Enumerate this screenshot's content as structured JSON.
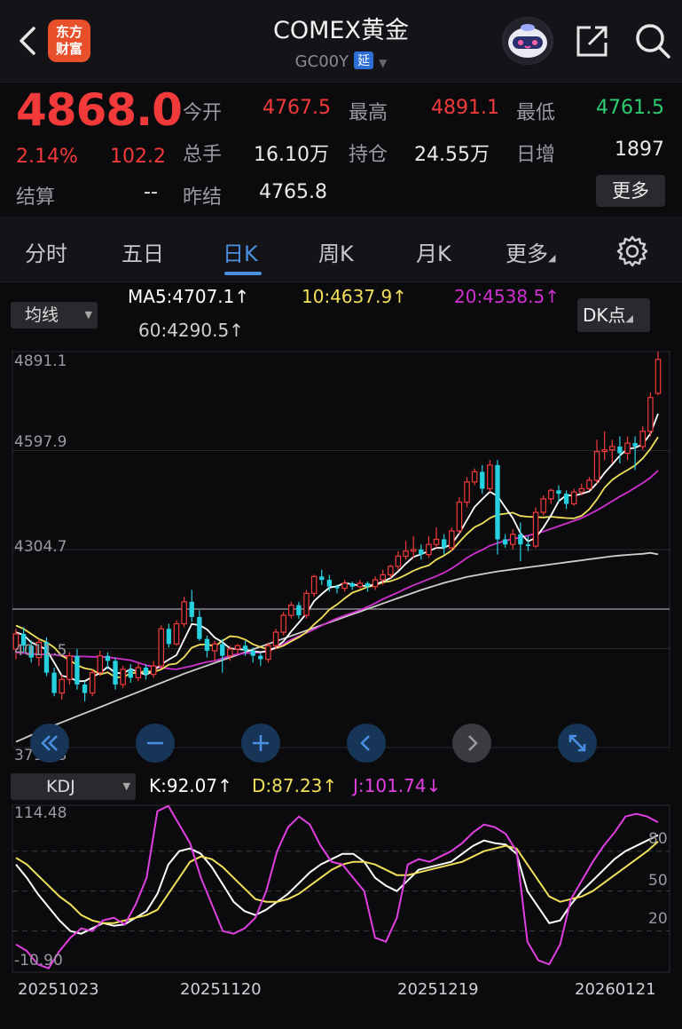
{
  "header": {
    "title": "COMEX黄金",
    "code": "GC00Y",
    "delay_badge": "延",
    "logo_line1": "东方",
    "logo_line2": "财富"
  },
  "quote": {
    "price": "4868.0",
    "change_pct": "2.14%",
    "change": "102.2",
    "open_label": "今开",
    "open": "4767.5",
    "high_label": "最高",
    "high": "4891.1",
    "low_label": "最低",
    "low": "4761.5",
    "volume_label": "总手",
    "volume": "16.10万",
    "oi_label": "持仓",
    "oi": "24.55万",
    "daily_inc_label": "日增",
    "daily_inc": "1897",
    "settle_label": "结算",
    "settle": "--",
    "prev_settle_label": "昨结",
    "prev_settle": "4765.8",
    "more_label": "更多"
  },
  "tabs": [
    "分时",
    "五日",
    "日K",
    "周K",
    "月K",
    "更多"
  ],
  "active_tab": "日K",
  "indicators": {
    "ma_select": "均线",
    "ma5": "MA5:4707.1↑",
    "ma10": "10:4637.9↑",
    "ma20": "20:4538.5↑",
    "ma60": "60:4290.5↑",
    "dk_button": "DK点",
    "kdj_select": "KDJ",
    "k": "K:92.07↑",
    "d": "D:87.23↑",
    "j": "J:101.74↓"
  },
  "colors": {
    "up": "#f23a3a",
    "down": "#27d0df",
    "ma5": "#ffffff",
    "ma10": "#f0e05a",
    "ma20": "#d030d0",
    "ma60": "#cfcfcf",
    "accent": "#4a90e2"
  },
  "chart_data": [
    {
      "type": "candlestick",
      "title": "",
      "y_ticks": [
        "4891.1",
        "4597.9",
        "4304.7",
        "4011.5",
        "3718.3"
      ],
      "ylim": [
        3718.3,
        4891.1
      ],
      "x_ticks": [
        "20251023",
        "20251120",
        "20251219",
        "20260121"
      ],
      "candles": [
        [
          4010,
          4055,
          3980,
          4070
        ],
        [
          4055,
          4020,
          4000,
          4075
        ],
        [
          4020,
          3985,
          3970,
          4035
        ],
        [
          3985,
          4030,
          3960,
          4040
        ],
        [
          4030,
          3940,
          3930,
          4045
        ],
        [
          3940,
          3880,
          3870,
          3955
        ],
        [
          3880,
          3920,
          3860,
          3935
        ],
        [
          3920,
          3990,
          3905,
          4000
        ],
        [
          3990,
          3905,
          3890,
          4010
        ],
        [
          3905,
          3880,
          3855,
          3915
        ],
        [
          3880,
          3940,
          3870,
          3950
        ],
        [
          3940,
          3990,
          3930,
          4005
        ],
        [
          3990,
          3975,
          3950,
          4000
        ],
        [
          3975,
          3905,
          3890,
          3985
        ],
        [
          3905,
          3950,
          3895,
          3960
        ],
        [
          3950,
          3925,
          3910,
          3965
        ],
        [
          3925,
          3955,
          3915,
          3970
        ],
        [
          3955,
          3935,
          3920,
          3965
        ],
        [
          3935,
          3960,
          3925,
          3975
        ],
        [
          3960,
          4070,
          3955,
          4080
        ],
        [
          4070,
          4025,
          4015,
          4085
        ],
        [
          4025,
          4085,
          4020,
          4095
        ],
        [
          4085,
          4150,
          4075,
          4165
        ],
        [
          4150,
          4105,
          4090,
          4185
        ],
        [
          4105,
          4040,
          4035,
          4125
        ],
        [
          4040,
          4005,
          3985,
          4050
        ],
        [
          4005,
          4025,
          3975,
          4035
        ],
        [
          4025,
          3990,
          3940,
          4040
        ],
        [
          3990,
          4010,
          3975,
          4020
        ],
        [
          4010,
          4020,
          3995,
          4025
        ],
        [
          4020,
          4005,
          3990,
          4035
        ],
        [
          4005,
          3990,
          3970,
          4015
        ],
        [
          3990,
          3980,
          3960,
          4000
        ],
        [
          3980,
          4020,
          3970,
          4030
        ],
        [
          4020,
          4060,
          4010,
          4070
        ],
        [
          4060,
          4110,
          4050,
          4120
        ],
        [
          4110,
          4140,
          4100,
          4150
        ],
        [
          4140,
          4110,
          4100,
          4150
        ],
        [
          4110,
          4175,
          4100,
          4185
        ],
        [
          4175,
          4225,
          4165,
          4230
        ],
        [
          4225,
          4215,
          4200,
          4245
        ],
        [
          4215,
          4195,
          4180,
          4230
        ],
        [
          4195,
          4190,
          4175,
          4200
        ],
        [
          4190,
          4205,
          4180,
          4215
        ],
        [
          4205,
          4195,
          4185,
          4210
        ],
        [
          4195,
          4205,
          4190,
          4215
        ],
        [
          4205,
          4195,
          4180,
          4210
        ],
        [
          4195,
          4215,
          4185,
          4225
        ],
        [
          4215,
          4230,
          4200,
          4245
        ],
        [
          4230,
          4255,
          4220,
          4260
        ],
        [
          4255,
          4285,
          4245,
          4300
        ],
        [
          4285,
          4300,
          4275,
          4330
        ],
        [
          4300,
          4305,
          4280,
          4345
        ],
        [
          4305,
          4290,
          4275,
          4320
        ],
        [
          4290,
          4320,
          4280,
          4345
        ],
        [
          4320,
          4335,
          4310,
          4370
        ],
        [
          4335,
          4310,
          4290,
          4350
        ],
        [
          4310,
          4360,
          4300,
          4370
        ],
        [
          4360,
          4445,
          4350,
          4460
        ],
        [
          4445,
          4505,
          4430,
          4520
        ],
        [
          4505,
          4535,
          4495,
          4545
        ],
        [
          4535,
          4485,
          4470,
          4555
        ],
        [
          4485,
          4555,
          4475,
          4570
        ],
        [
          4555,
          4335,
          4290,
          4570
        ],
        [
          4335,
          4320,
          4310,
          4350
        ],
        [
          4320,
          4350,
          4305,
          4365
        ],
        [
          4350,
          4320,
          4270,
          4385
        ],
        [
          4320,
          4315,
          4300,
          4345
        ],
        [
          4315,
          4415,
          4310,
          4430
        ],
        [
          4415,
          4455,
          4405,
          4465
        ],
        [
          4455,
          4480,
          4440,
          4485
        ],
        [
          4480,
          4470,
          4445,
          4495
        ],
        [
          4470,
          4440,
          4425,
          4480
        ],
        [
          4440,
          4475,
          4435,
          4485
        ],
        [
          4475,
          4485,
          4465,
          4500
        ],
        [
          4485,
          4510,
          4480,
          4520
        ],
        [
          4510,
          4595,
          4500,
          4630
        ],
        [
          4595,
          4600,
          4570,
          4655
        ],
        [
          4600,
          4610,
          4560,
          4630
        ],
        [
          4610,
          4590,
          4560,
          4640
        ],
        [
          4590,
          4620,
          4570,
          4640
        ],
        [
          4620,
          4610,
          4540,
          4640
        ],
        [
          4610,
          4655,
          4600,
          4670
        ],
        [
          4655,
          4755,
          4640,
          4770
        ],
        [
          4767.5,
          4868,
          4761.5,
          4891.1
        ]
      ],
      "ma5": [
        4060,
        4052,
        4030,
        4020,
        4008,
        3970,
        3931,
        3926,
        3915,
        3915,
        3928,
        3939,
        3957,
        3940,
        3938,
        3951,
        3942,
        3934,
        3945,
        3965,
        3979,
        3992,
        4038,
        4084,
        4081,
        4068,
        4044,
        4031,
        4012,
        4010,
        4008,
        4004,
        4001,
        4005,
        4015,
        4033,
        4062,
        4088,
        4115,
        4152,
        4173,
        4192,
        4196,
        4206,
        4202,
        4198,
        4197,
        4202,
        4210,
        4220,
        4240,
        4263,
        4283,
        4291,
        4300,
        4310,
        4310,
        4321,
        4353,
        4392,
        4431,
        4454,
        4476,
        4463,
        4430,
        4398,
        4353,
        4329,
        4340,
        4370,
        4406,
        4448,
        4466,
        4464,
        4470,
        4477,
        4501,
        4532,
        4557,
        4583,
        4603,
        4606,
        4617,
        4648,
        4707.1
      ],
      "ma10": [
        4080,
        4070,
        4055,
        4040,
        4030,
        4015,
        3990,
        3978,
        3962,
        3953,
        3949,
        3935,
        3941,
        3927,
        3926,
        3939,
        3940,
        3945,
        3942,
        3950,
        3964,
        3967,
        3986,
        4014,
        4023,
        4024,
        4018,
        4034,
        4048,
        4046,
        4038,
        4024,
        4016,
        4009,
        4012,
        4020,
        4033,
        4045,
        4060,
        4083,
        4103,
        4127,
        4142,
        4160,
        4177,
        4185,
        4194,
        4199,
        4208,
        4211,
        4219,
        4230,
        4242,
        4251,
        4258,
        4275,
        4287,
        4302,
        4327,
        4351,
        4371,
        4382,
        4398,
        4408,
        4411,
        4414,
        4404,
        4402,
        4401,
        4400,
        4402,
        4400,
        4398,
        4397,
        4405,
        4424,
        4453,
        4488,
        4511,
        4527,
        4540,
        4554,
        4575,
        4603,
        4637.9
      ],
      "ma20": [
        4000,
        3998,
        3996,
        3995,
        3994,
        3993,
        3990,
        3989,
        3988,
        3988,
        3987,
        3987,
        3986,
        3983,
        3980,
        3977,
        3970,
        3962,
        3958,
        3955,
        3952,
        3950,
        3955,
        3960,
        3966,
        3972,
        3975,
        3982,
        3990,
        3995,
        3998,
        3999,
        4000,
        4004,
        4013,
        4025,
        4038,
        4048,
        4058,
        4068,
        4080,
        4091,
        4101,
        4109,
        4117,
        4125,
        4135,
        4146,
        4158,
        4168,
        4178,
        4189,
        4199,
        4208,
        4217,
        4226,
        4236,
        4249,
        4264,
        4280,
        4293,
        4304,
        4316,
        4324,
        4331,
        4336,
        4341,
        4346,
        4352,
        4358,
        4366,
        4374,
        4382,
        4390,
        4398,
        4409,
        4421,
        4434,
        4448,
        4462,
        4474,
        4488,
        4502,
        4518,
        4538.5
      ],
      "ma60": [
        3735,
        3745,
        3755,
        3765,
        3775,
        3784,
        3793,
        3802,
        3811,
        3820,
        3829,
        3838,
        3847,
        3856,
        3865,
        3874,
        3883,
        3892,
        3901,
        3910,
        3919,
        3928,
        3937,
        3945,
        3953,
        3961,
        3969,
        3977,
        3985,
        3993,
        4001,
        4009,
        4017,
        4025,
        4033,
        4041,
        4049,
        4057,
        4065,
        4073,
        4081,
        4089,
        4097,
        4105,
        4113,
        4121,
        4129,
        4137,
        4145,
        4153,
        4161,
        4169,
        4177,
        4185,
        4192,
        4199,
        4206,
        4212,
        4218,
        4224,
        4228,
        4232,
        4236,
        4240,
        4243,
        4246,
        4249,
        4252,
        4255,
        4258,
        4261,
        4264,
        4267,
        4270,
        4273,
        4276,
        4279,
        4282,
        4285,
        4287,
        4289,
        4290.5,
        4292,
        4295,
        4290.5
      ]
    },
    {
      "type": "line",
      "title": "",
      "y_ticks": [
        "114.48",
        "80",
        "50",
        "20",
        "-10.90"
      ],
      "ylim": [
        -10.9,
        114.48
      ],
      "series": [
        {
          "name": "K",
          "values": [
            70,
            60,
            48,
            38,
            28,
            20,
            18,
            22,
            26,
            24,
            25,
            30,
            35,
            48,
            70,
            80,
            82,
            78,
            68,
            55,
            42,
            35,
            32,
            36,
            42,
            48,
            56,
            64,
            70,
            74,
            78,
            78,
            72,
            60,
            54,
            50,
            58,
            66,
            68,
            70,
            72,
            78,
            84,
            88,
            86,
            85,
            78,
            50,
            38,
            26,
            28,
            40,
            50,
            58,
            66,
            74,
            80,
            84,
            88,
            92.07
          ]
        },
        {
          "name": "D",
          "values": [
            75,
            70,
            62,
            54,
            46,
            40,
            32,
            28,
            26,
            26,
            28,
            30,
            32,
            36,
            48,
            60,
            72,
            76,
            74,
            68,
            60,
            52,
            44,
            42,
            42,
            44,
            48,
            54,
            60,
            66,
            70,
            72,
            72,
            70,
            66,
            62,
            62,
            64,
            66,
            68,
            70,
            72,
            76,
            80,
            82,
            84,
            82,
            70,
            58,
            46,
            42,
            44,
            46,
            50,
            56,
            62,
            68,
            74,
            80,
            87.23
          ]
        },
        {
          "name": "J",
          "values": [
            10,
            5,
            -5,
            -8,
            5,
            15,
            22,
            20,
            28,
            30,
            25,
            40,
            60,
            110,
            114,
            100,
            86,
            60,
            40,
            20,
            18,
            22,
            30,
            50,
            80,
            98,
            106,
            100,
            84,
            72,
            70,
            60,
            50,
            15,
            12,
            30,
            70,
            74,
            72,
            76,
            80,
            86,
            94,
            100,
            98,
            93,
            80,
            12,
            -2,
            -5,
            10,
            44,
            58,
            72,
            84,
            94,
            106,
            108,
            106,
            101.74
          ]
        }
      ],
      "x_ticks": [
        "20251023",
        "20251120",
        "20251219",
        "20260121"
      ]
    }
  ]
}
